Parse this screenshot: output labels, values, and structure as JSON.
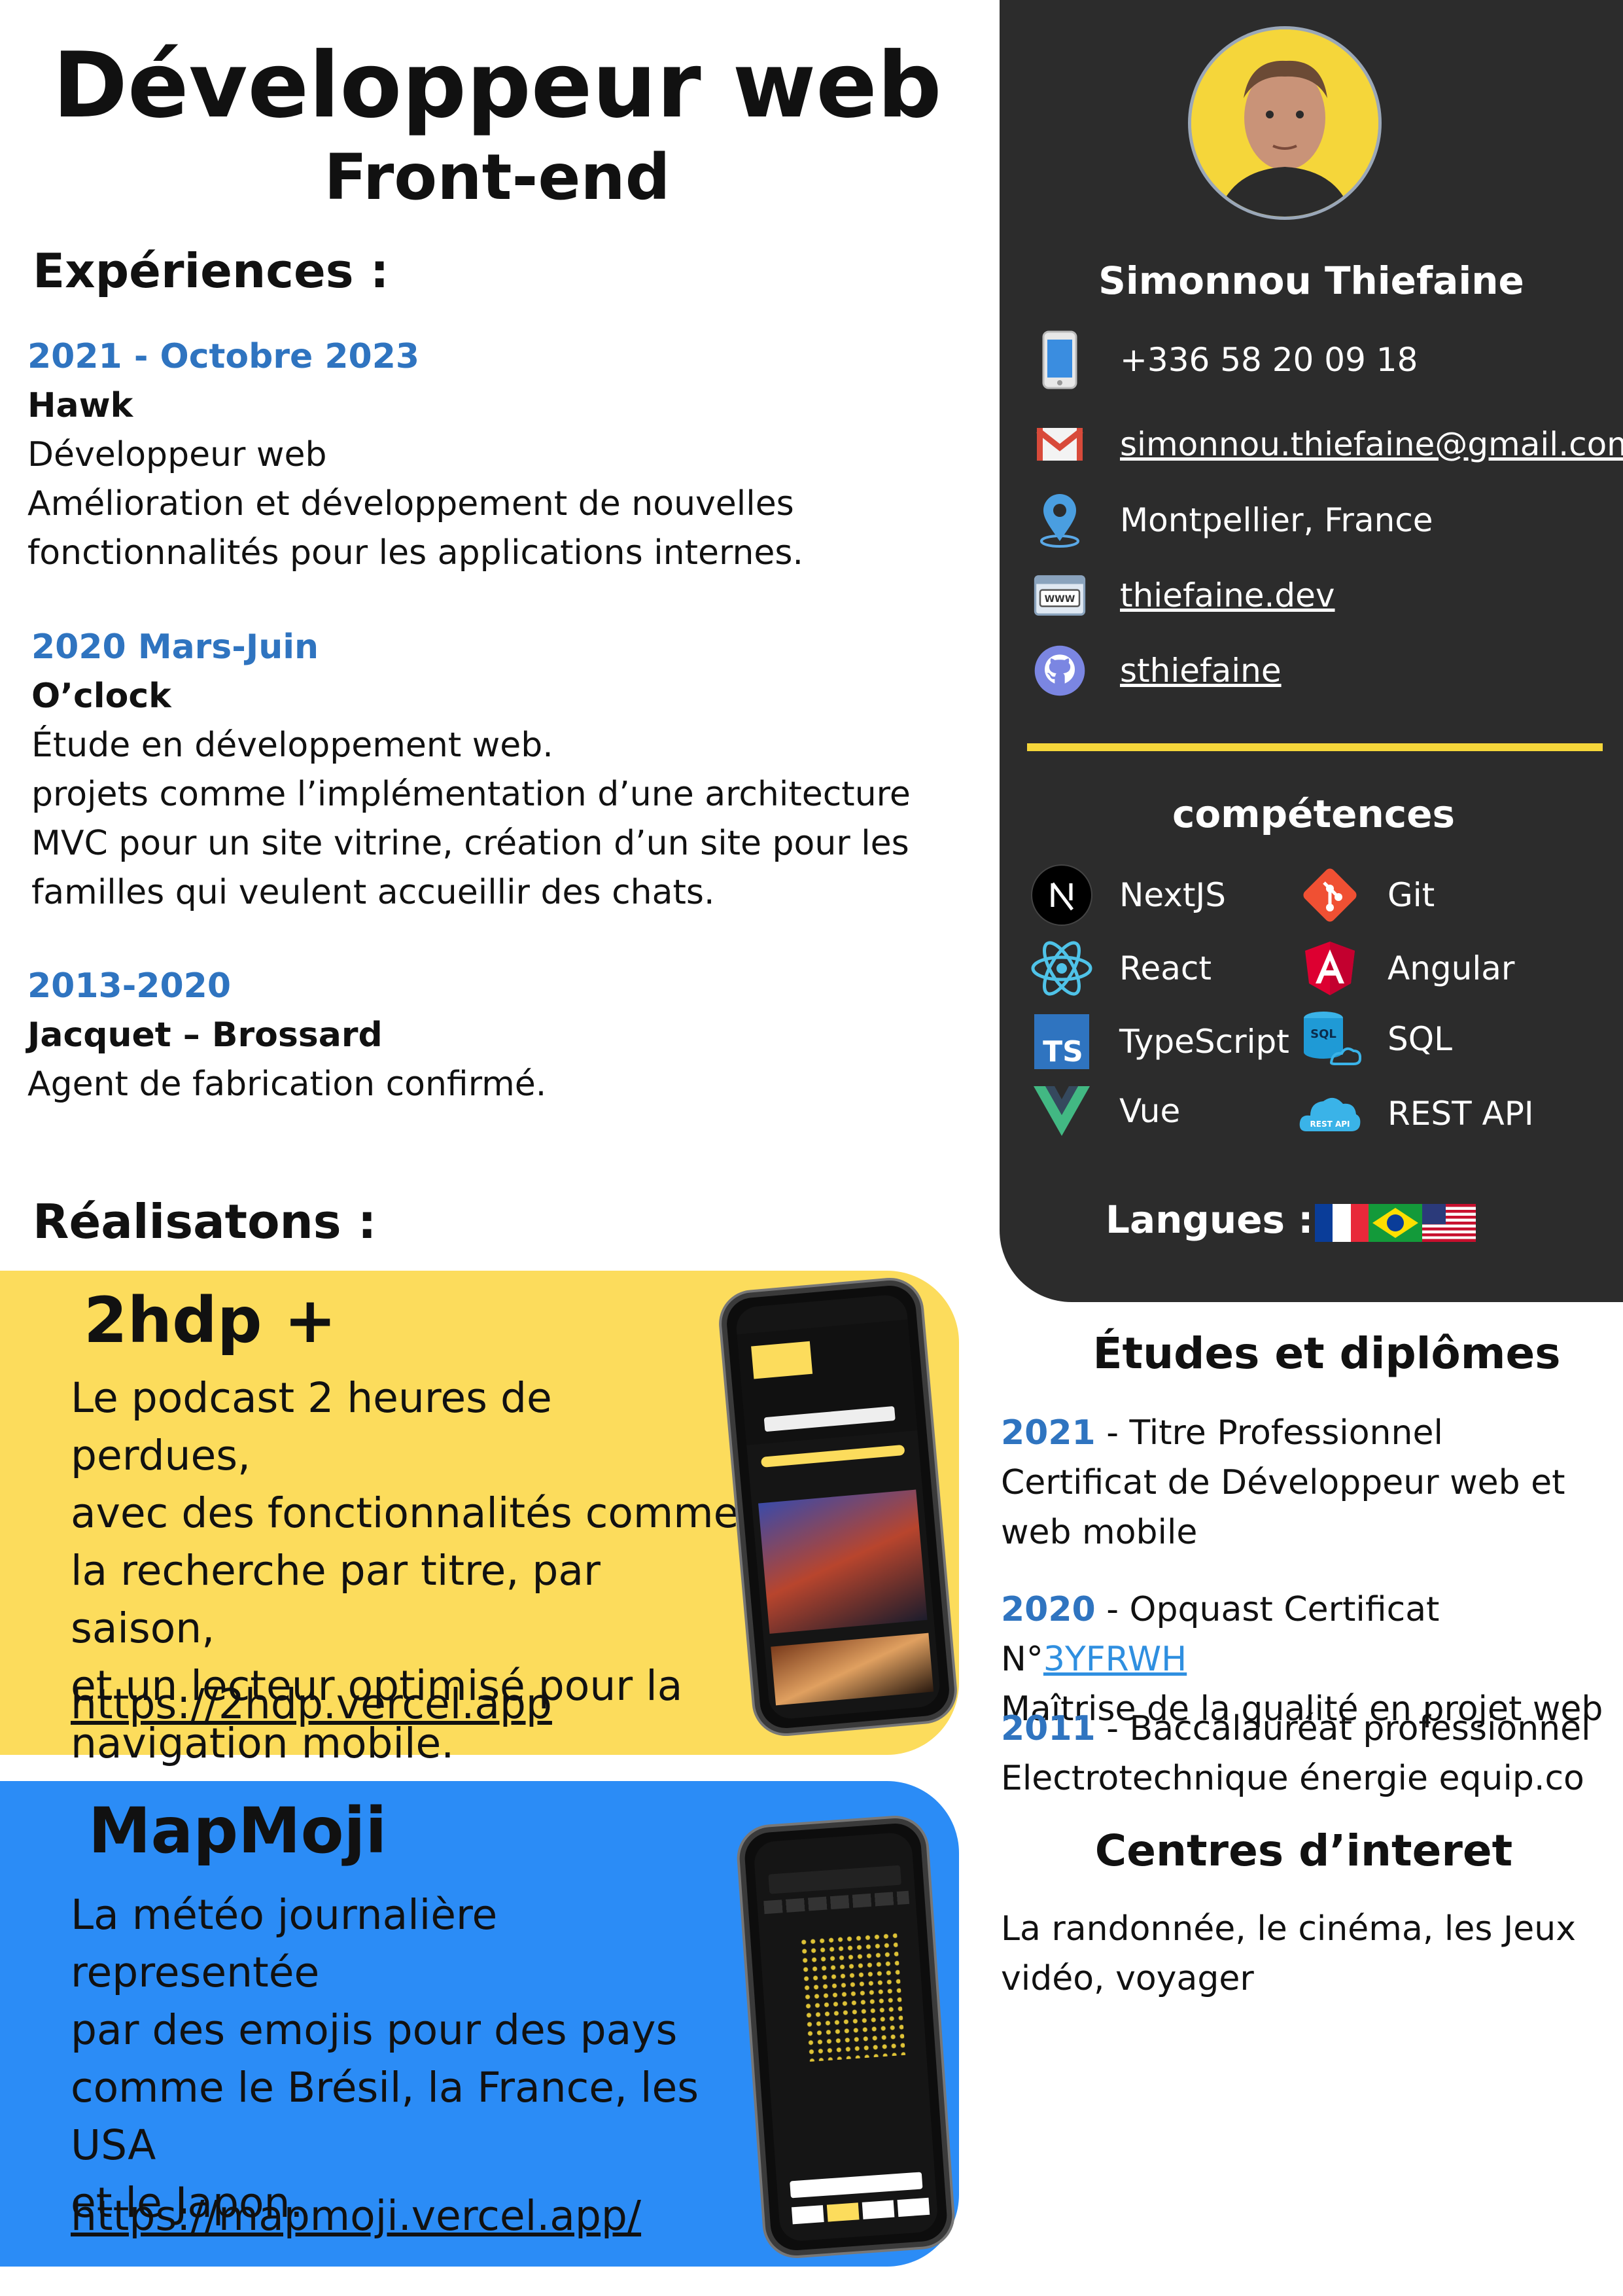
{
  "header": {
    "title": "Développeur web",
    "subtitle": "Front-end"
  },
  "experiences": {
    "heading": "Expériences :",
    "items": [
      {
        "date": "2021 - Octobre 2023",
        "company": "Hawk",
        "lines": [
          "Développeur web",
          "Amélioration et développement de nouvelles",
          "fonctionnalités pour les applications internes."
        ]
      },
      {
        "date": "2020 Mars-Juin",
        "company": "O’clock",
        "lines": [
          "Étude en développement web.",
          "projets comme l’implémentation d’une architecture",
          "MVC pour un site vitrine, création d’un site pour les",
          "familles qui veulent accueillir des chats."
        ]
      },
      {
        "date": "2013-2020",
        "company": "Jacquet – Brossard",
        "lines": [
          "Agent de fabrication confirmé."
        ]
      }
    ]
  },
  "profile": {
    "name": "Simonnou Thiefaine",
    "contacts": [
      {
        "icon": "phone-icon",
        "text": "+336 58 20 09 18"
      },
      {
        "icon": "mail-icon",
        "text": "simonnou.thiefaine@gmail.com"
      },
      {
        "icon": "location-pin-icon",
        "text": "Montpellier, France"
      },
      {
        "icon": "www-icon",
        "text": "thiefaine.dev"
      },
      {
        "icon": "github-icon",
        "text": "sthiefaine"
      }
    ],
    "skills_heading": "compétences",
    "skills": [
      {
        "icon": "nextjs-icon",
        "label": "NextJS"
      },
      {
        "icon": "git-icon",
        "label": "Git"
      },
      {
        "icon": "react-icon",
        "label": "React"
      },
      {
        "icon": "angular-icon",
        "label": "Angular"
      },
      {
        "icon": "typescript-icon",
        "label": "TypeScript",
        "badge": "TS"
      },
      {
        "icon": "sql-icon",
        "label": "SQL",
        "badge": "SQL"
      },
      {
        "icon": "vue-icon",
        "label": "Vue"
      },
      {
        "icon": "rest-api-icon",
        "label": "REST API",
        "badge": "REST API"
      }
    ],
    "languages_label": "Langues :",
    "languages": [
      "france-flag-icon",
      "brazil-flag-icon",
      "usa-flag-icon"
    ]
  },
  "projects": {
    "heading": "Réalisatons :",
    "items": [
      {
        "name": "2hdp +",
        "lines": [
          "Le podcast 2 heures de perdues,",
          "avec des fonctionnalités comme",
          "la recherche par titre, par saison,",
          "et un lecteur optimisé pour la",
          "navigation mobile."
        ],
        "link": "https://2hdp.vercel.app"
      },
      {
        "name": "MapMoji",
        "lines": [
          "La météo journalière representée",
          "par des emojis pour des pays",
          "comme le Brésil, la France, les USA",
          "et le Japon."
        ],
        "link": "https://mapmoji.vercel.app/"
      }
    ]
  },
  "education": {
    "heading": "Études et diplômes",
    "items": [
      {
        "year": "2021",
        "title": " - Titre Professionnel",
        "lines": [
          "Certificat de Développeur web et",
          "web mobile"
        ]
      },
      {
        "year": "2020",
        "title": " - Opquast Certificat N°",
        "cert": "3YFRWH",
        "lines": [
          "Maîtrise de la qualité en projet web"
        ]
      },
      {
        "year": "2011",
        "title": " - Baccalauréat professionnel",
        "lines": [
          "Electrotechnique énergie equip.co"
        ]
      }
    ]
  },
  "interests": {
    "heading": "Centres d’interet",
    "lines": [
      "La randonnée, le cinéma, les Jeux",
      "vidéo, voyager"
    ]
  },
  "colors": {
    "panel": "#2c2c2c",
    "accent_yellow": "#fcdc5c",
    "accent_blue": "#2b8cf6",
    "date_blue": "#2f74c0"
  }
}
